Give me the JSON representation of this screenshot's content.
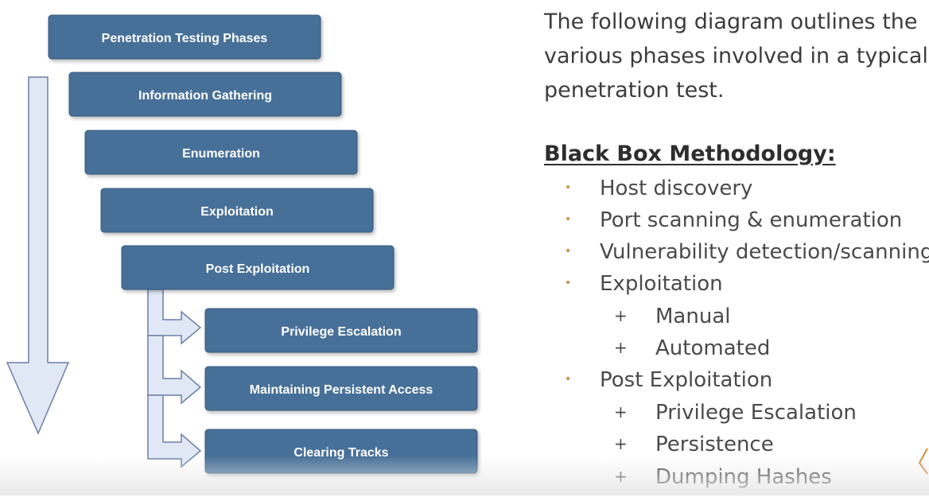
{
  "diagram": {
    "title": "Penetration Testing Phases",
    "phases": [
      "Information Gathering",
      "Enumeration",
      "Exploitation",
      "Post Exploitation"
    ],
    "sub_phases": [
      "Privilege Escalation",
      "Maintaining Persistent Access",
      "Clearing Tracks"
    ]
  },
  "description": {
    "lines": [
      "The following diagram outlines the",
      "various phases involved in a typical",
      "penetration test."
    ]
  },
  "methodology": {
    "heading": "Black Box Methodology:",
    "items": [
      "Host discovery",
      "Port scanning & enumeration",
      "Vulnerability detection/scanning",
      "Exploitation",
      "Manual",
      "Automated",
      "Post Exploitation",
      "Privilege Escalation",
      "Persistence",
      "Dumping Hashes"
    ]
  },
  "colors": {
    "box_fill": "#476f98",
    "box_stroke": "#36587c",
    "arrow_fill": "#e0e8f6",
    "arrow_stroke": "#6c7fa6",
    "bullet": "#d08a43"
  },
  "icons": {
    "bullet": "dot-bullet-icon",
    "sub_bullet": "plus-bullet-icon"
  }
}
